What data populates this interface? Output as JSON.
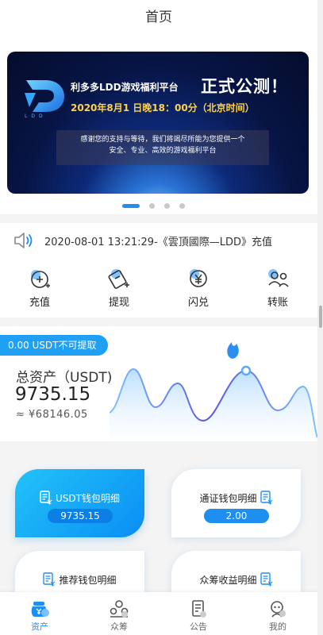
{
  "header": {
    "title": "首页"
  },
  "banner": {
    "logo_text": "LDD",
    "headline": "利多多LDD游戏福利平台",
    "big_text": "正式公测！",
    "date_text": "2020年8月1 日晚18：00分（北京时间）",
    "sub_line1": "感谢您的支持与等待，我们将竭尽所能为您提供一个",
    "sub_line2": "安全、专业、高效的游戏福利平台",
    "dots_total": 4,
    "active_dot": 1
  },
  "notice": {
    "text": "2020-08-01 13:21:29-《雲頂國際—LDD》充值",
    "icon": "speaker-icon"
  },
  "actions": [
    {
      "label": "充值",
      "icon": "deposit-icon"
    },
    {
      "label": "提现",
      "icon": "withdraw-icon"
    },
    {
      "label": "闪兑",
      "icon": "exchange-icon"
    },
    {
      "label": "转账",
      "icon": "transfer-icon"
    }
  ],
  "asset": {
    "tag": "0.00 USDT不可提取",
    "label": "总资产（USDT)",
    "value": "9735.15",
    "cny": "≈ ¥68146.05"
  },
  "wallets": [
    {
      "title": "USDT钱包明细",
      "value": "9735.15"
    },
    {
      "title": "通证钱包明细",
      "value": "2.00"
    },
    {
      "title": "推荐钱包明细"
    },
    {
      "title": "众筹收益明细"
    }
  ],
  "tabs": [
    {
      "label": "资产",
      "icon": "wallet-icon",
      "active": true
    },
    {
      "label": "众筹",
      "icon": "crowdfund-icon",
      "active": false
    },
    {
      "label": "公告",
      "icon": "announcement-icon",
      "active": false
    },
    {
      "label": "我的",
      "icon": "profile-icon",
      "active": false
    }
  ],
  "colors": {
    "accent": "#1f8ef1",
    "accent_light": "#22c3f8",
    "text": "#333333",
    "background": "#f4f4f4"
  }
}
